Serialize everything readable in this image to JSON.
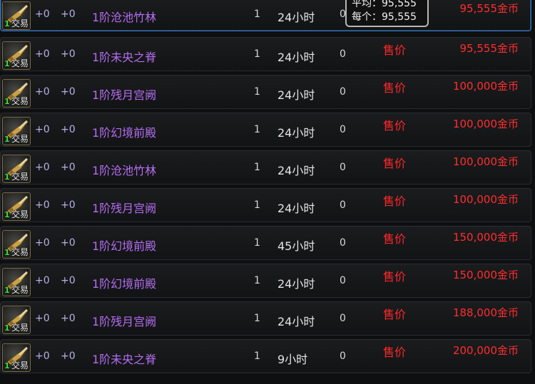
{
  "tooltip": {
    "line1": "平均：95,555",
    "line2": "每个：95,555"
  },
  "rows": [
    {
      "qty": "1",
      "trade": "交易",
      "p1": "+0",
      "p2": "+0",
      "name": "1阶沧池竹林",
      "count": "1",
      "time": "24小时",
      "bid": "0",
      "label": "",
      "price": "95,555金币"
    },
    {
      "qty": "1",
      "trade": "交易",
      "p1": "+0",
      "p2": "+0",
      "name": "1阶未央之脊",
      "count": "1",
      "time": "24小时",
      "bid": "0",
      "label": "售价",
      "price": "95,555金币"
    },
    {
      "qty": "1",
      "trade": "交易",
      "p1": "+0",
      "p2": "+0",
      "name": "1阶残月宫阙",
      "count": "1",
      "time": "24小时",
      "bid": "0",
      "label": "售价",
      "price": "100,000金币"
    },
    {
      "qty": "1",
      "trade": "交易",
      "p1": "+0",
      "p2": "+0",
      "name": "1阶幻境前殿",
      "count": "1",
      "time": "24小时",
      "bid": "0",
      "label": "售价",
      "price": "100,000金币"
    },
    {
      "qty": "1",
      "trade": "交易",
      "p1": "+0",
      "p2": "+0",
      "name": "1阶沧池竹林",
      "count": "1",
      "time": "24小时",
      "bid": "0",
      "label": "售价",
      "price": "100,000金币"
    },
    {
      "qty": "1",
      "trade": "交易",
      "p1": "+0",
      "p2": "+0",
      "name": "1阶残月宫阙",
      "count": "1",
      "time": "24小时",
      "bid": "0",
      "label": "售价",
      "price": "100,000金币"
    },
    {
      "qty": "1",
      "trade": "交易",
      "p1": "+0",
      "p2": "+0",
      "name": "1阶幻境前殿",
      "count": "1",
      "time": "45小时",
      "bid": "0",
      "label": "售价",
      "price": "150,000金币"
    },
    {
      "qty": "1",
      "trade": "交易",
      "p1": "+0",
      "p2": "+0",
      "name": "1阶幻境前殿",
      "count": "1",
      "time": "24小时",
      "bid": "0",
      "label": "售价",
      "price": "150,000金币"
    },
    {
      "qty": "1",
      "trade": "交易",
      "p1": "+0",
      "p2": "+0",
      "name": "1阶残月宫阙",
      "count": "1",
      "time": "24小时",
      "bid": "0",
      "label": "售价",
      "price": "188,000金币"
    },
    {
      "qty": "1",
      "trade": "交易",
      "p1": "+0",
      "p2": "+0",
      "name": "1阶未央之脊",
      "count": "1",
      "time": "9小时",
      "bid": "0",
      "label": "售价",
      "price": "200,000金币"
    }
  ],
  "icon": "trade-ticket-icon"
}
